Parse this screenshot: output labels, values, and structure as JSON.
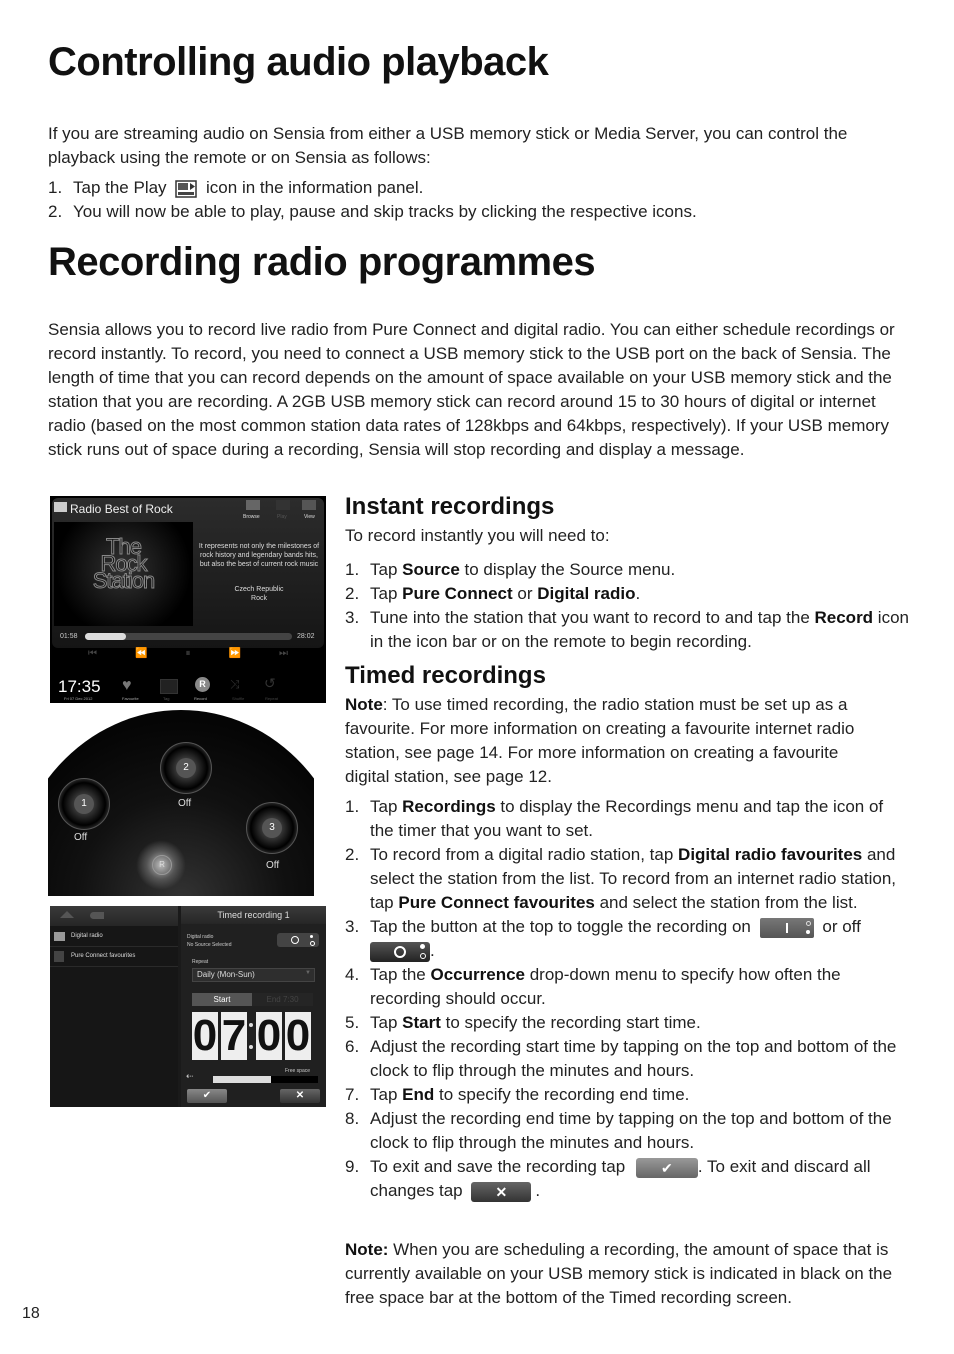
{
  "section1": {
    "title": "Controlling audio playback",
    "intro": "If you are streaming audio on Sensia from either a USB memory stick or Media Server, you can control the playback using the remote or on Sensia as follows:",
    "steps": [
      {
        "n": "1.",
        "pre": "Tap the Play",
        "icon": "play-panel-icon",
        "post": "icon in the information panel."
      },
      {
        "n": "2.",
        "text": "You will now be able to play, pause and skip tracks by clicking the respective icons."
      }
    ]
  },
  "section2": {
    "title": "Recording radio programmes",
    "intro": "Sensia allows you to record live radio from Pure Connect and digital radio. You can either schedule recordings or record instantly. To record, you need to connect a USB memory stick to the USB port on the back of Sensia. The length of time that you can record depends on the amount of space available on your USB memory stick and the station that you are recording. A 2GB USB memory stick can record around 15 to 30 hours of digital or internet radio (based on the most common station data rates of 128kbps and 64kbps, respectively). If your USB memory stick runs out of space during a recording, Sensia will stop recording and display a message."
  },
  "instant": {
    "title": "Instant recordings",
    "intro": "To record instantly you will need to:",
    "steps": [
      {
        "n": "1.",
        "a": "Tap ",
        "b": "Source",
        "c": " to display the Source menu."
      },
      {
        "n": "2.",
        "a": "Tap ",
        "b": "Pure Connect",
        "c": " or ",
        "d": "Digital radio",
        "e": "."
      },
      {
        "n": "3.",
        "a": "Tune into the station that you want to record to and tap the ",
        "b": "Record",
        "c": " icon in the icon bar or on the remote to begin recording."
      }
    ]
  },
  "timed": {
    "title": "Timed recordings",
    "note_label": "Note",
    "note_text": ": To use timed recording, the radio station must be set up as a favourite. For more information on creating a favourite internet radio station, see page 14. For more information on creating a favourite digital station, see page 12.",
    "steps": [
      {
        "n": "1.",
        "a": "Tap ",
        "b": "Recordings",
        "c": " to display the Recordings menu and tap the icon of the timer that you want to set."
      },
      {
        "n": "2.",
        "a": "To record from a digital radio station, tap ",
        "b": "Digital radio favourites",
        "c": " and select the station from the list. To record from an internet radio station, tap ",
        "d": "Pure Connect favourites",
        "e": " and select the station from the list."
      },
      {
        "n": "3.",
        "a": "Tap the button at the top to toggle the recording on",
        "c": "or off",
        "e": "."
      },
      {
        "n": "4.",
        "a": "Tap the ",
        "b": "Occurrence",
        "c": " drop-down menu to specify how often the recording should occur."
      },
      {
        "n": "5.",
        "a": "Tap ",
        "b": "Start",
        "c": " to specify the recording start time."
      },
      {
        "n": "6.",
        "a": "Adjust the recording start time by tapping on the top and bottom of the clock to flip through the minutes and hours."
      },
      {
        "n": "7.",
        "a": "Tap ",
        "b": "End",
        "c": " to specify the recording end time."
      },
      {
        "n": "8.",
        "a": "Adjust the recording end time by tapping on the top and bottom of the clock to flip through the minutes and hours."
      },
      {
        "n": "9.",
        "a": "To exit and save the recording tap",
        "c": ". To exit and discard all changes tap",
        "e": "."
      }
    ],
    "final_note_label": "Note:",
    "final_note_text": " When you are scheduling a recording, the amount of space that is currently available on your USB memory stick is indicated in black on the free space bar at the bottom of the Timed recording screen."
  },
  "page_number": "18",
  "screen1": {
    "station": "Radio Best of Rock",
    "top_icons": [
      "Browse",
      "Play",
      "View"
    ],
    "art_lines": [
      "The",
      "Rock",
      "Station"
    ],
    "description": "It represents not only the milestones of rock history and legendary bands hits, but also the best of current rock music",
    "country": "Czech Republic",
    "genre": "Rock",
    "elapsed": "01:58",
    "total": "28:02",
    "progress": 0.2,
    "clock": "17:35",
    "date": "Fri 07 Dec 2012",
    "bar_items": [
      "Favourite",
      "Tag",
      "Record",
      "Shuffle",
      "Repeat"
    ]
  },
  "screen2": {
    "timers": [
      {
        "num": "1",
        "status": "Off"
      },
      {
        "num": "2",
        "status": "Off"
      },
      {
        "num": "3",
        "status": "Off"
      }
    ],
    "record_label": "R"
  },
  "screen3": {
    "left_items": [
      "Digital radio",
      "Pure Connect favourites"
    ],
    "title": "Timed recording 1",
    "source_type": "Digital radio",
    "source_value": "No Source Selected",
    "repeat_label": "Repeat",
    "repeat_value": "Daily (Mon-Sun)",
    "tab_start": "Start",
    "tab_end": "End 7:30",
    "digits": [
      "0",
      "7",
      "0",
      "0"
    ],
    "free_space_label": "Free space",
    "free_space_used": 0.55
  }
}
